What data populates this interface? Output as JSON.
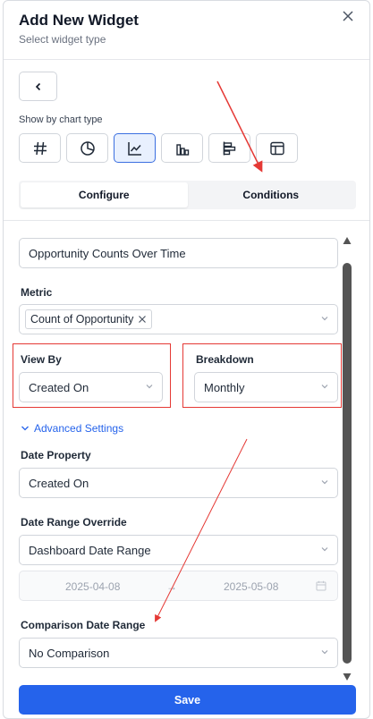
{
  "header": {
    "title": "Add New Widget",
    "subtitle": "Select widget type"
  },
  "chart_section": {
    "label": "Show by chart type",
    "types": [
      {
        "icon": "hash-icon",
        "selected": false
      },
      {
        "icon": "pie-chart-icon",
        "selected": false
      },
      {
        "icon": "line-chart-icon",
        "selected": true
      },
      {
        "icon": "bar-chart-icon",
        "selected": false
      },
      {
        "icon": "horizontal-bar-chart-icon",
        "selected": false
      },
      {
        "icon": "table-icon",
        "selected": false
      }
    ]
  },
  "tabs": [
    {
      "label": "Configure",
      "active": true
    },
    {
      "label": "Conditions",
      "active": false
    }
  ],
  "form": {
    "widget_title": "Opportunity Counts Over Time",
    "metric_label": "Metric",
    "metric_chip": "Count of Opportunity",
    "view_by_label": "View By",
    "view_by_value": "Created On",
    "breakdown_label": "Breakdown",
    "breakdown_value": "Monthly",
    "advanced_settings": "Advanced Settings",
    "date_property_label": "Date Property",
    "date_property_value": "Created On",
    "date_range_override_label": "Date Range Override",
    "date_range_override_value": "Dashboard Date Range",
    "date_start": "2025-04-08",
    "date_separator": "→",
    "date_end": "2025-05-08",
    "comparison_label": "Comparison Date Range",
    "comparison_value": "No Comparison"
  },
  "footer": {
    "save_label": "Save"
  },
  "colors": {
    "accent": "#2563eb",
    "annotation": "#e53935",
    "selected_bg": "#e8f0fe"
  }
}
